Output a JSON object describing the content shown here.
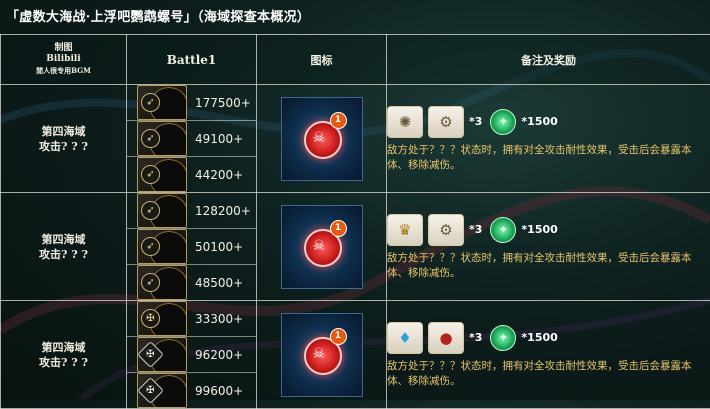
{
  "title": "「虚数大海战·上浮吧鹦鹉螺号」（海域探查本概况）",
  "header": {
    "col1_line1": "制图",
    "col1_line2": "Bilibili",
    "col1_line3": "閒人很专用BGM",
    "battle": "Battle1",
    "icon": "图标",
    "notes": "备注及奖励"
  },
  "rows": [
    {
      "region_line1": "第四海域",
      "region_line2": "攻击? ? ?",
      "enemies": [
        {
          "class": "archer",
          "hp": "177500+"
        },
        {
          "class": "archer",
          "hp": "49100+"
        },
        {
          "class": "archer",
          "hp": "44200+"
        }
      ],
      "badge": "1",
      "rewards": {
        "mult": "*3",
        "qp": "*1500"
      },
      "note": "敌方处于？？？状态时，拥有对全攻击耐性效果，受击后会暴露本体、移除减伤。"
    },
    {
      "region_line1": "第四海域",
      "region_line2": "攻击? ? ?",
      "enemies": [
        {
          "class": "archer",
          "hp": "128200+"
        },
        {
          "class": "archer",
          "hp": "50100+"
        },
        {
          "class": "archer",
          "hp": "48500+"
        }
      ],
      "badge": "1",
      "rewards": {
        "mult": "*3",
        "qp": "*1500"
      },
      "note": "敌方处于？？？状态时，拥有对全攻击耐性效果，受击后会暴露本体、移除减伤。"
    },
    {
      "region_line1": "第四海域",
      "region_line2": "攻击? ? ?",
      "enemies": [
        {
          "class": "beast",
          "hp": "33300+"
        },
        {
          "class": "silver",
          "hp": "96200+"
        },
        {
          "class": "silver",
          "hp": "99600+"
        }
      ],
      "badge": "1",
      "rewards": {
        "mult": "*3",
        "qp": "*1500"
      },
      "note": "敌方处于？？？状态时，拥有对全攻击耐性效果，受击后会暴露本体、移除减伤。"
    }
  ],
  "icons": {
    "reward_row1": [
      "gear-item-icon",
      "bronze-gear-item-icon",
      "qp-icon"
    ],
    "reward_row2": [
      "gold-bell-item-icon",
      "bronze-gear-item-icon",
      "qp-icon"
    ],
    "reward_row3": [
      "crystal-lantern-item-icon",
      "red-drop-item-icon",
      "qp-icon"
    ],
    "danger": "skull-danger-icon"
  },
  "colors": {
    "note_text": "#e7c56a",
    "border": "#e1e1d7",
    "danger": "#c51818",
    "qp": "#1fa85a"
  }
}
